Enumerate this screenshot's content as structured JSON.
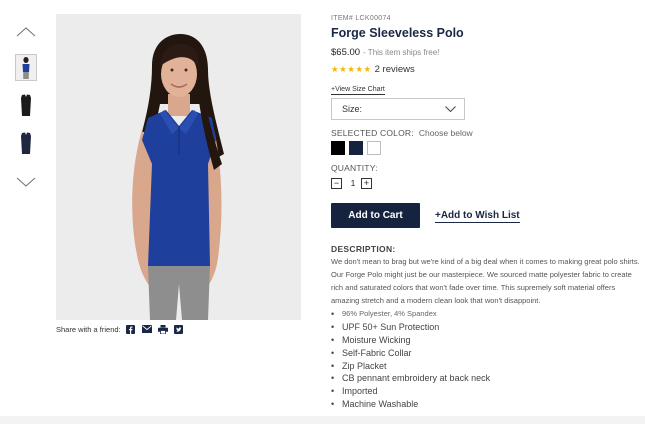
{
  "gallery": {
    "thumbnails": [
      {
        "name": "thumb-model-front",
        "active": true
      },
      {
        "name": "thumb-black-polo",
        "active": false
      },
      {
        "name": "thumb-navy-polo",
        "active": false
      }
    ]
  },
  "share": {
    "label": "Share with a friend:",
    "icons": [
      "facebook-icon",
      "email-icon",
      "print-icon",
      "twitter-icon"
    ]
  },
  "product": {
    "item_number": "ITEM# LCK00074",
    "title": "Forge Sleeveless Polo",
    "price": "$65.00",
    "shipping_note": "- This item ships free!",
    "stars": "★★★★★",
    "rating": 5,
    "reviews": "2 reviews",
    "size_chart_link": "+View Size Chart",
    "size_select": {
      "label": "Size:"
    },
    "selected_color": {
      "label": "SELECTED COLOR:",
      "value": "Choose below"
    },
    "swatches": [
      {
        "name": "black",
        "color": "#000000"
      },
      {
        "name": "navy",
        "color": "#16233f"
      },
      {
        "name": "white",
        "color": "#ffffff"
      }
    ],
    "quantity": {
      "label": "QUANTITY:",
      "value": "1",
      "minus": "−",
      "plus": "+"
    },
    "add_to_cart": "Add to Cart",
    "add_to_wishlist": "+Add to Wish List"
  },
  "description": {
    "heading": "DESCRIPTION:",
    "text": "We don't mean to brag but we're kind of a big deal when it comes to making great polo shirts.  Our Forge Polo might just be our masterpiece. We sourced matte polyester fabric to create rich and saturated colors that won't fade over time. This supremely soft material offers amazing stretch and a modern clean look that won't disappoint.",
    "features": [
      "96% Polyester, 4% Spandex",
      "UPF 50+ Sun Protection",
      "Moisture Wicking",
      "Self-Fabric Collar",
      "Zip Placket",
      "CB pennant embroidery at back neck",
      "Imported",
      "Machine Washable"
    ]
  },
  "colors": {
    "brand_navy": "#16233f",
    "star_gold": "#f5b800",
    "polo_blue": "#1f3f9c"
  }
}
